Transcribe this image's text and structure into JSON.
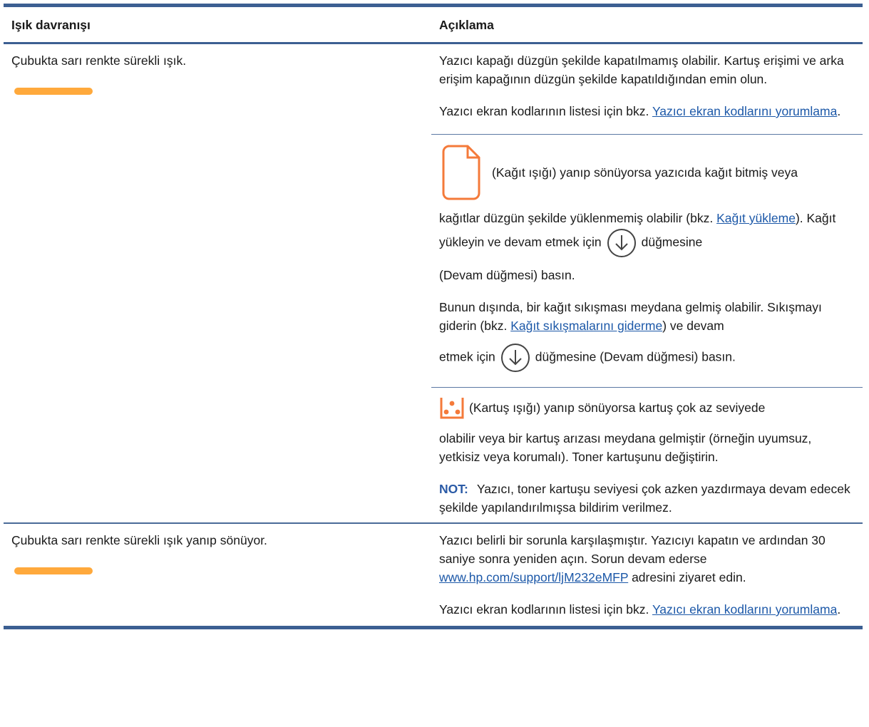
{
  "header": {
    "col1": "Işık davranışı",
    "col2": "Açıklama"
  },
  "row1": {
    "behavior": "Çubukta sarı renkte sürekli ışık.",
    "desc1": "Yazıcı kapağı düzgün şekilde kapatılmamış olabilir. Kartuş erişimi ve arka erişim kapağının düzgün şekilde kapatıldığından emin olun.",
    "desc2_prefix": "Yazıcı ekran kodlarının listesi için bkz. ",
    "desc2_link": "Yazıcı ekran kodlarını yorumlama",
    "desc2_suffix": ".",
    "paper_text1": " (Kağıt ışığı) yanıp sönüyorsa yazıcıda kağıt bitmiş veya",
    "paper_text2_prefix": "kağıtlar düzgün şekilde yüklenmemiş olabilir (bkz. ",
    "paper_link": "Kağıt yükleme",
    "paper_text2_mid": "). Kağıt yükleyin ve devam etmek için",
    "paper_text2_suffix": "düğmesine",
    "paper_text3": "(Devam düğmesi) basın.",
    "jam_text1": "Bunun dışında, bir kağıt sıkışması meydana gelmiş olabilir. Sıkışmayı giderin (bkz. ",
    "jam_link": "Kağıt sıkışmalarını giderme",
    "jam_text2": ") ve devam",
    "jam_text3_prefix": "etmek için",
    "jam_text3_suffix": "düğmesine (Devam düğmesi) basın.",
    "cart_text1": "(Kartuş ışığı) yanıp sönüyorsa kartuş çok az seviyede",
    "cart_text2": "olabilir veya bir kartuş arızası meydana gelmiştir (örneğin uyumsuz, yetkisiz veya korumalı). Toner kartuşunu değiştirin.",
    "note_label": "NOT:",
    "note_text": "Yazıcı, toner kartuşu seviyesi çok azken yazdırmaya devam edecek şekilde yapılandırılmışsa bildirim verilmez."
  },
  "row2": {
    "behavior": "Çubukta sarı renkte sürekli ışık yanıp sönüyor.",
    "desc1_prefix": "Yazıcı belirli bir sorunla karşılaşmıştır. Yazıcıyı kapatın ve ardından 30 saniye sonra yeniden açın. Sorun devam ederse ",
    "desc1_link": "www.hp.com/support/ljM232eMFP",
    "desc1_suffix": " adresini ziyaret edin.",
    "desc2_prefix": "Yazıcı ekran kodlarının listesi için bkz. ",
    "desc2_link": "Yazıcı ekran kodlarını yorumlama",
    "desc2_suffix": "."
  },
  "colors": {
    "rule": "#3c5f92",
    "link": "#1c58a8",
    "light_bar": "#ffa93c",
    "icon_orange": "#f47a3a"
  }
}
